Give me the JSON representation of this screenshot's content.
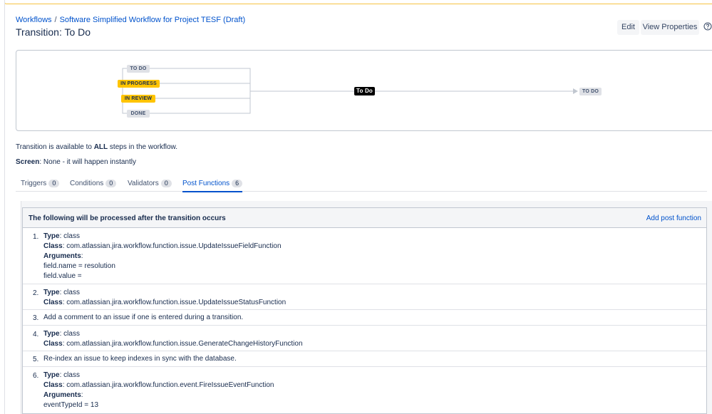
{
  "breadcrumb": {
    "workflows": "Workflows",
    "separator": "/",
    "workflow_name": "Software Simplified Workflow for Project TESF (Draft)"
  },
  "page_title": "Transition: To Do",
  "buttons": {
    "edit": "Edit",
    "view_properties": "View Properties"
  },
  "help_icon": "question-circle-icon",
  "diagram": {
    "source_statuses": [
      {
        "label": "TO DO",
        "color": "#dfe1e6"
      },
      {
        "label": "IN PROGRESS",
        "color": "#ffc400"
      },
      {
        "label": "IN REVIEW",
        "color": "#ffc400"
      },
      {
        "label": "DONE",
        "color": "#dfe1e6"
      }
    ],
    "transition_label": "To Do",
    "target_status": "TO DO"
  },
  "info": {
    "availability_prefix": "Transition is available to",
    "availability_bold": "ALL",
    "availability_suffix": "steps in the workflow.",
    "screen_label": "Screen",
    "screen_value": ": None - it will happen instantly"
  },
  "tabs": [
    {
      "label": "Triggers",
      "count": "0"
    },
    {
      "label": "Conditions",
      "count": "0"
    },
    {
      "label": "Validators",
      "count": "0"
    },
    {
      "label": "Post Functions",
      "count": "6"
    }
  ],
  "post_functions": {
    "header": "The following will be processed after the transition occurs",
    "add_label": "Add post function",
    "labels": {
      "type": "Type",
      "class": "Class",
      "arguments": "Arguments"
    },
    "items": [
      {
        "num": "1.",
        "type": ": class",
        "class": ": com.atlassian.jira.workflow.function.issue.UpdateIssueFieldFunction",
        "has_args": ":",
        "args": [
          "field.name = resolution",
          "field.value ="
        ]
      },
      {
        "num": "2.",
        "type": ": class",
        "class": ": com.atlassian.jira.workflow.function.issue.UpdateIssueStatusFunction"
      },
      {
        "num": "3.",
        "text": "Add a comment to an issue if one is entered during a transition."
      },
      {
        "num": "4.",
        "type": ": class",
        "class": ": com.atlassian.jira.workflow.function.issue.GenerateChangeHistoryFunction"
      },
      {
        "num": "5.",
        "text": "Re-index an issue to keep indexes in sync with the database."
      },
      {
        "num": "6.",
        "type": ": class",
        "class": ": com.atlassian.jira.workflow.function.event.FireIssueEventFunction",
        "has_args": ":",
        "args": [
          "eventTypeId = 13"
        ]
      }
    ]
  }
}
